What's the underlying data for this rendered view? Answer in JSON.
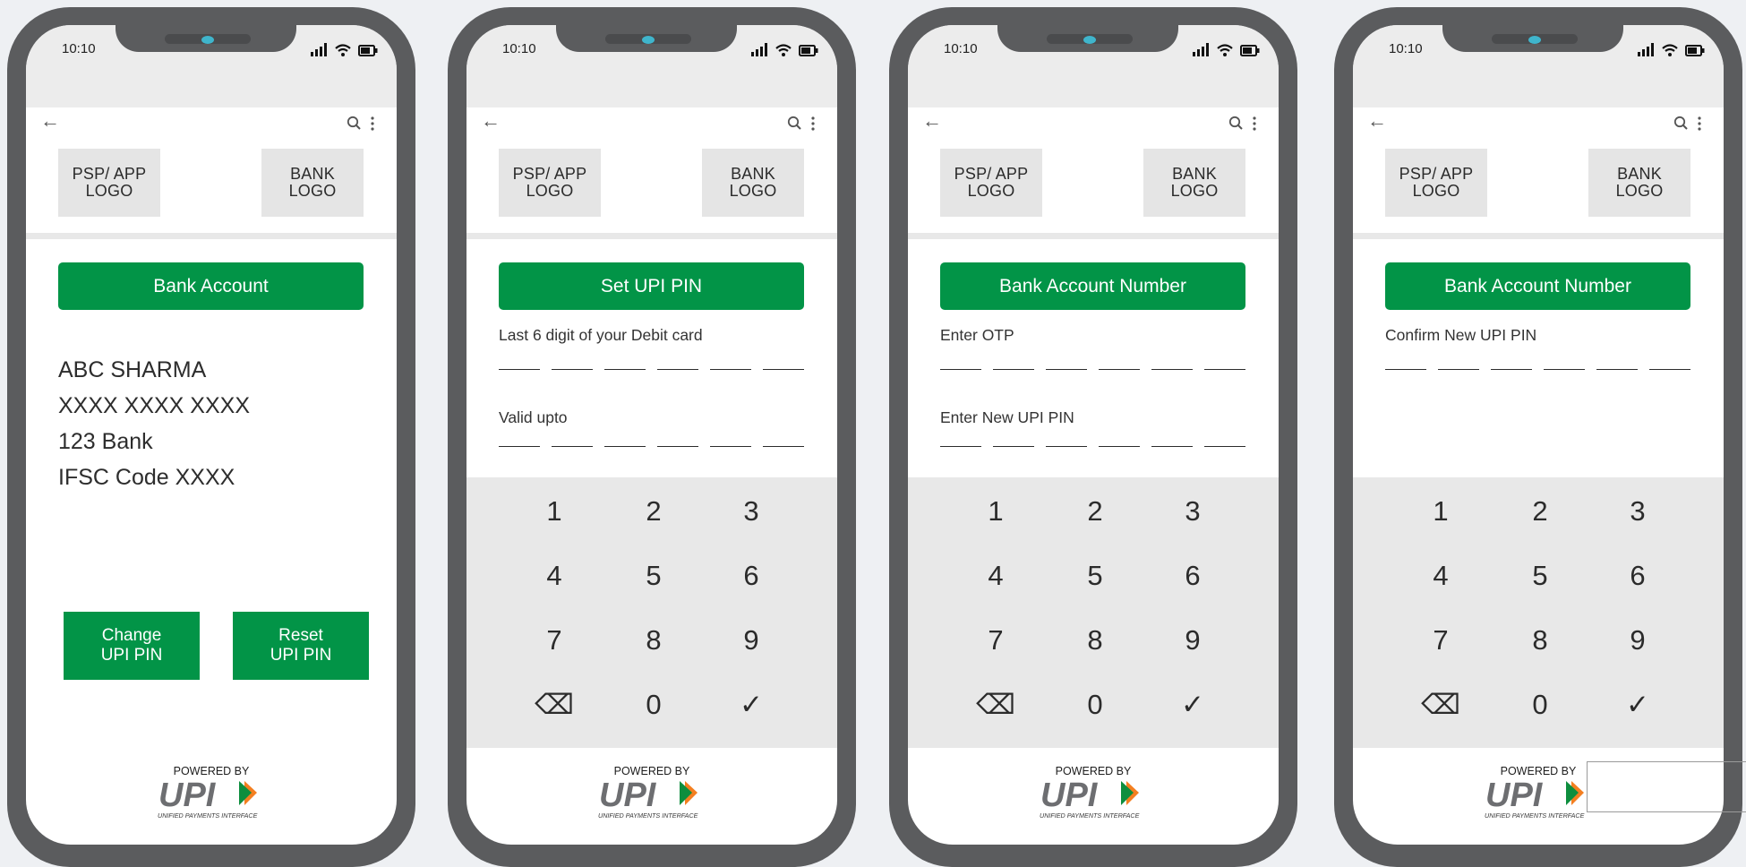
{
  "colors": {
    "brand_green": "#029447",
    "frame": "#5b5c5e",
    "keypad_bg": "#e8e8e8"
  },
  "status_bar": {
    "time": "10:10"
  },
  "logos": {
    "psp": "PSP/ APP\nLOGO",
    "bank": "BANK\nLOGO"
  },
  "keypad": {
    "keys": [
      "1",
      "2",
      "3",
      "4",
      "5",
      "6",
      "7",
      "8",
      "9",
      "⌫",
      "0",
      "✓"
    ]
  },
  "footer": {
    "powered_by": "POWERED BY",
    "upi_mark": "UPI",
    "upi_tagline": "UNIFIED PAYMENTS INTERFACE"
  },
  "screens": [
    {
      "title": "Bank Account",
      "details": [
        "ABC SHARMA",
        "XXXX XXXX XXXX",
        "123 Bank",
        "IFSC Code XXXX"
      ],
      "change_button": "Change\nUPI PIN",
      "reset_button": "Reset\nUPI PIN"
    },
    {
      "title": "Set UPI PIN",
      "field1_label": "Last 6 digit of your Debit card",
      "field2_label": "Valid upto"
    },
    {
      "title": "Bank Account Number",
      "field1_label": "Enter OTP",
      "field2_label": "Enter New UPI PIN"
    },
    {
      "title": "Bank Account Number",
      "field1_label": "Confirm New UPI PIN"
    }
  ]
}
